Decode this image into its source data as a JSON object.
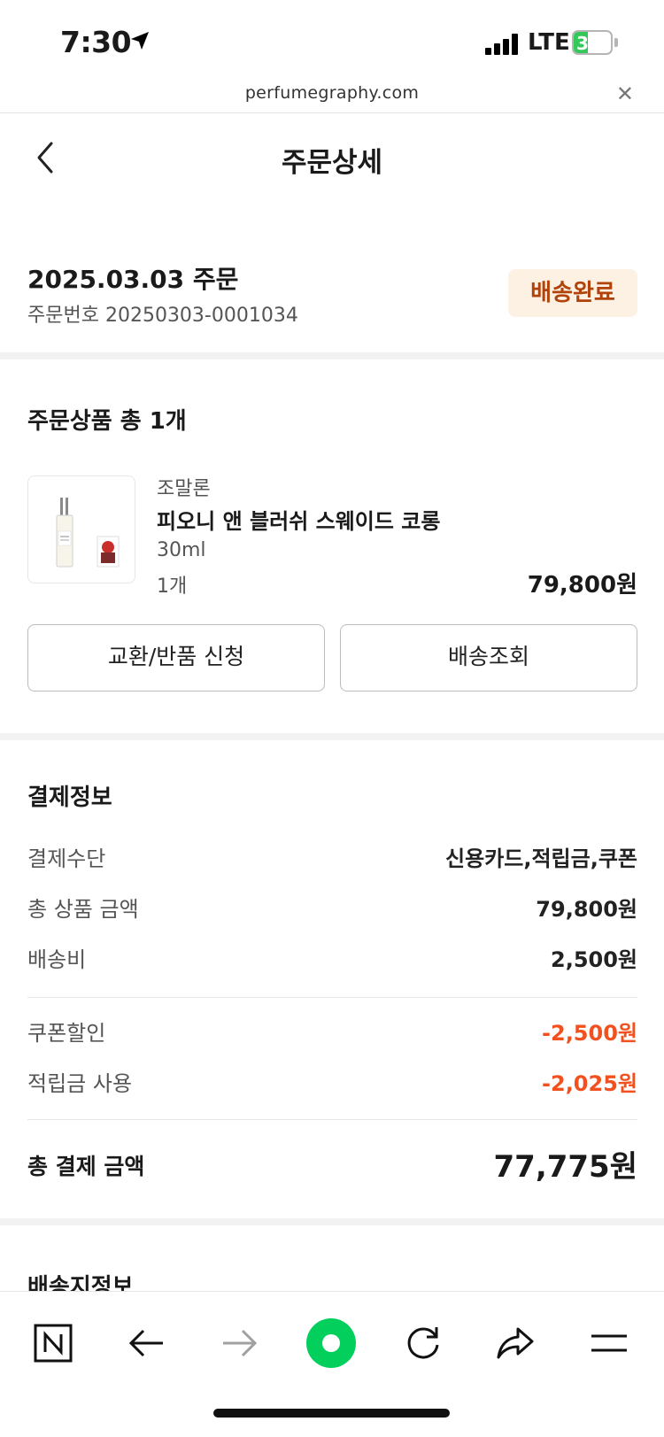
{
  "status_bar": {
    "time": "7:30",
    "network": "LTE",
    "battery_level": "39",
    "battery_fraction": 0.39
  },
  "browser": {
    "url": "perfumegraphy.com"
  },
  "header": {
    "title": "주문상세"
  },
  "order": {
    "date_label": "2025.03.03 주문",
    "number_label": "주문번호 20250303-0001034",
    "status": "배송완료"
  },
  "products": {
    "section_title": "주문상품 총 1개",
    "item": {
      "brand": "조말론",
      "name": "피오니 앤 블러쉬 스웨이드 코롱",
      "option": "30ml",
      "quantity": "1개",
      "price": "79,800원"
    },
    "exchange_button": "교환/반품 신청",
    "tracking_button": "배송조회"
  },
  "payment": {
    "section_title": "결제정보",
    "rows": [
      {
        "label": "결제수단",
        "value": "신용카드,적립금,쿠폰"
      },
      {
        "label": "총 상품 금액",
        "value": "79,800원"
      },
      {
        "label": "배송비",
        "value": "2,500원"
      }
    ],
    "discounts": [
      {
        "label": "쿠폰할인",
        "value": "-2,500원"
      },
      {
        "label": "적립금 사용",
        "value": "-2,025원"
      }
    ],
    "total_label": "총 결제 금액",
    "total_value": "77,775원"
  },
  "delivery": {
    "section_title": "배송지정보"
  },
  "toolbar": {
    "icons": [
      "naver-home-icon",
      "back-arrow-icon",
      "forward-arrow-icon",
      "green-dot-icon",
      "refresh-icon",
      "share-icon",
      "menu-icon"
    ]
  },
  "colors": {
    "accent_discount": "#f2501f",
    "status_badge_bg": "#fdf1e4",
    "status_badge_text": "#b0420a",
    "green_button": "#03cf5d"
  }
}
